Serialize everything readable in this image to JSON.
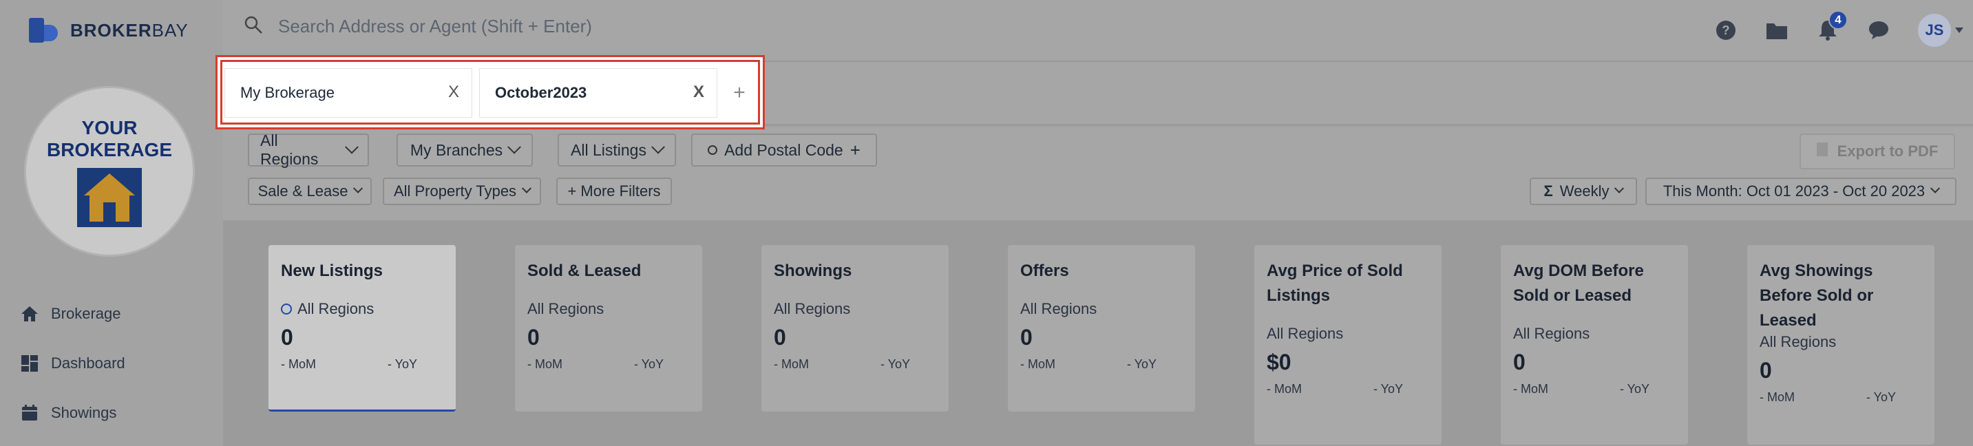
{
  "app": {
    "logo_main": "BROKER",
    "logo_bay": "BAY"
  },
  "brokerage_logo": {
    "line1": "YOUR",
    "line2": "BROKERAGE"
  },
  "sidebar": {
    "items": [
      {
        "label": "Brokerage",
        "icon": "home-icon"
      },
      {
        "label": "Dashboard",
        "icon": "dashboard-icon"
      },
      {
        "label": "Showings",
        "icon": "calendar-icon"
      }
    ]
  },
  "search": {
    "placeholder": "Search Address or Agent (Shift + Enter)"
  },
  "header": {
    "notification_count": "4",
    "avatar_initials": "JS"
  },
  "tabs": [
    {
      "label": "My Brokerage",
      "close": "X"
    },
    {
      "label": "October2023",
      "close": "X"
    }
  ],
  "tab_add": "+",
  "filters": {
    "regions": "All Regions",
    "branches": "My Branches",
    "listings": "All Listings",
    "postal": "Add Postal Code",
    "sale_lease": "Sale & Lease",
    "property_types": "All Property Types",
    "more_filters": "+ More Filters",
    "frequency": "Weekly",
    "date_range": "This Month: Oct 01 2023 - Oct 20 2023",
    "export": "Export to PDF"
  },
  "cards": [
    {
      "title": "New Listings",
      "region": "All Regions",
      "value": "0",
      "mom": "- MoM",
      "yoy": "- YoY"
    },
    {
      "title": "Sold & Leased",
      "region": "All Regions",
      "value": "0",
      "mom": "- MoM",
      "yoy": "- YoY"
    },
    {
      "title": "Showings",
      "region": "All Regions",
      "value": "0",
      "mom": "- MoM",
      "yoy": "- YoY"
    },
    {
      "title": "Offers",
      "region": "All Regions",
      "value": "0",
      "mom": "- MoM",
      "yoy": "- YoY"
    },
    {
      "title": "Avg Price of Sold Listings",
      "region": "All Regions",
      "value": "$0",
      "mom": "- MoM",
      "yoy": "- YoY"
    },
    {
      "title": "Avg DOM Before Sold or Leased",
      "region": "All Regions",
      "value": "0",
      "mom": "- MoM",
      "yoy": "- YoY"
    },
    {
      "title": "Avg Showings Before Sold or Leased",
      "region": "All Regions",
      "value": "0",
      "mom": "- MoM",
      "yoy": "- YoY"
    }
  ],
  "colors": {
    "accent": "#2448a6",
    "highlight": "#d43e2f"
  }
}
